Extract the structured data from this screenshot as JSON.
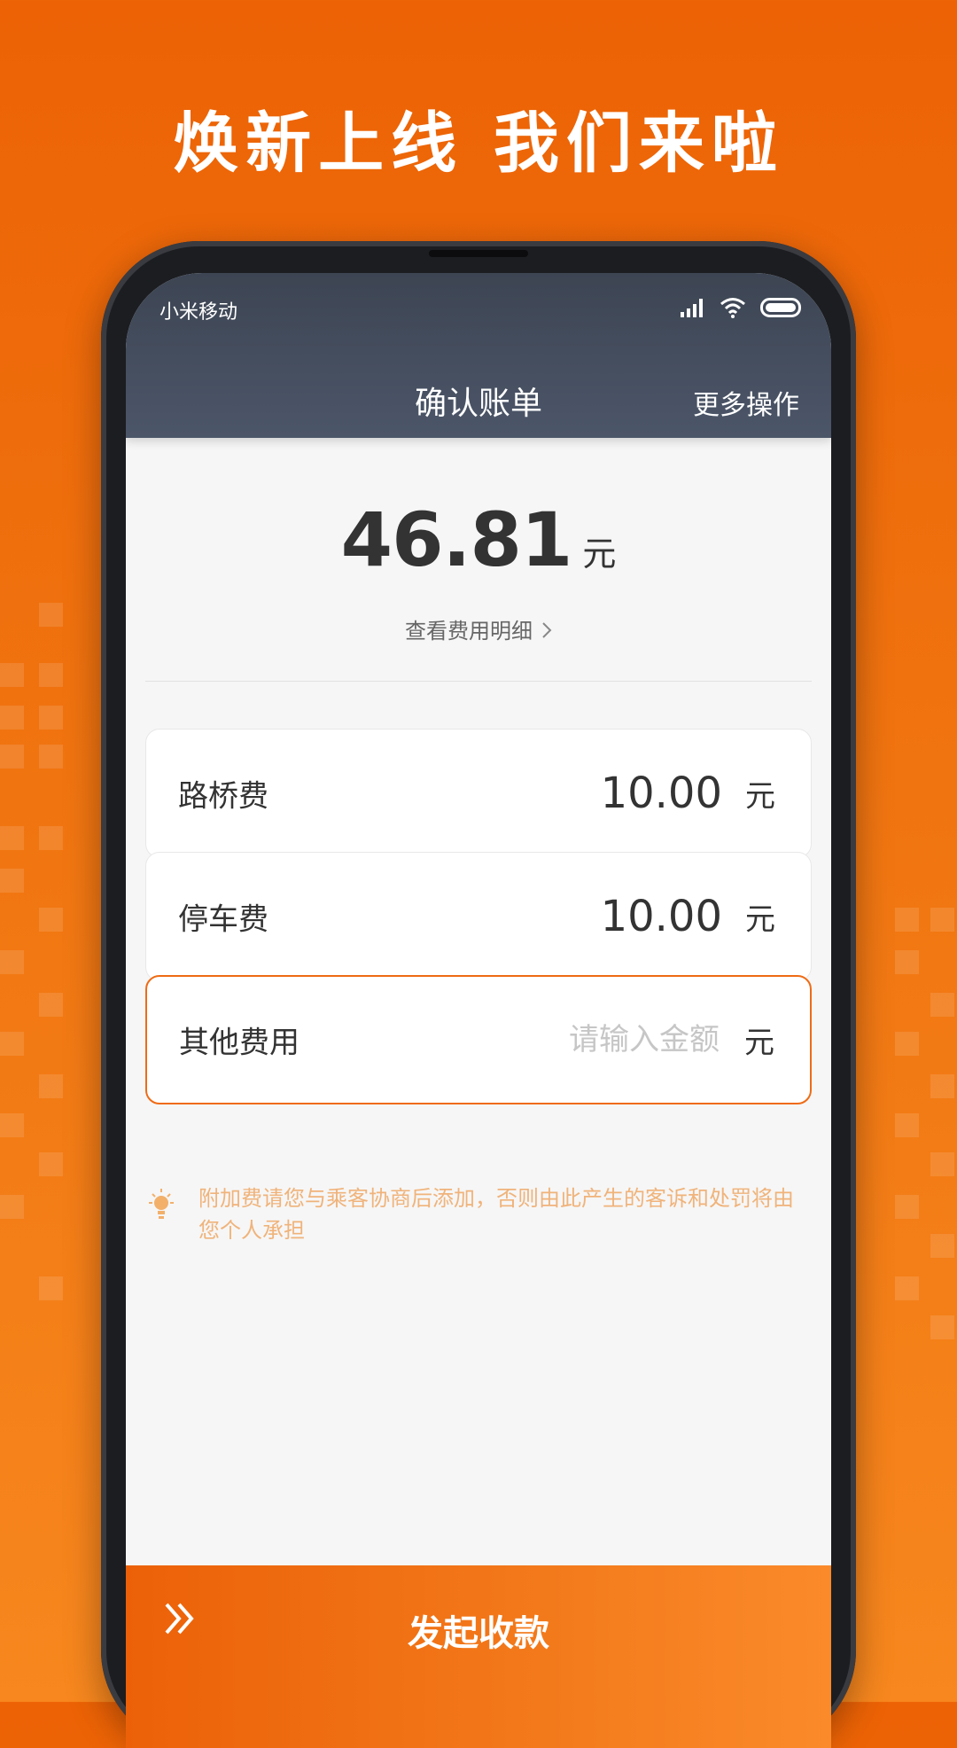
{
  "headline": "焕新上线 我们来啦",
  "status_bar": {
    "carrier": "小米移动",
    "icons": [
      "signal-icon",
      "wifi-icon",
      "battery-icon"
    ]
  },
  "app_bar": {
    "title": "确认账单",
    "more_label": "更多操作"
  },
  "summary": {
    "amount": "46.81",
    "unit": "元",
    "detail_link": "查看费用明细"
  },
  "fees": [
    {
      "label": "路桥费",
      "value": "10.00",
      "unit": "元"
    },
    {
      "label": "停车费",
      "value": "10.00",
      "unit": "元"
    },
    {
      "label": "其他费用",
      "value": "",
      "placeholder": "请输入金额",
      "unit": "元"
    }
  ],
  "notice": {
    "icon": "lightbulb-icon",
    "text": "附加费请您与乘客协商后添加，否则由此产生的客诉和处罚将由您个人承担"
  },
  "action": {
    "icon": "double-chevron-right-icon",
    "label": "发起收款"
  },
  "colors": {
    "brand_orange": "#ef6b14",
    "header_dark": "#434b5c",
    "notice_text": "#f0b37a"
  }
}
